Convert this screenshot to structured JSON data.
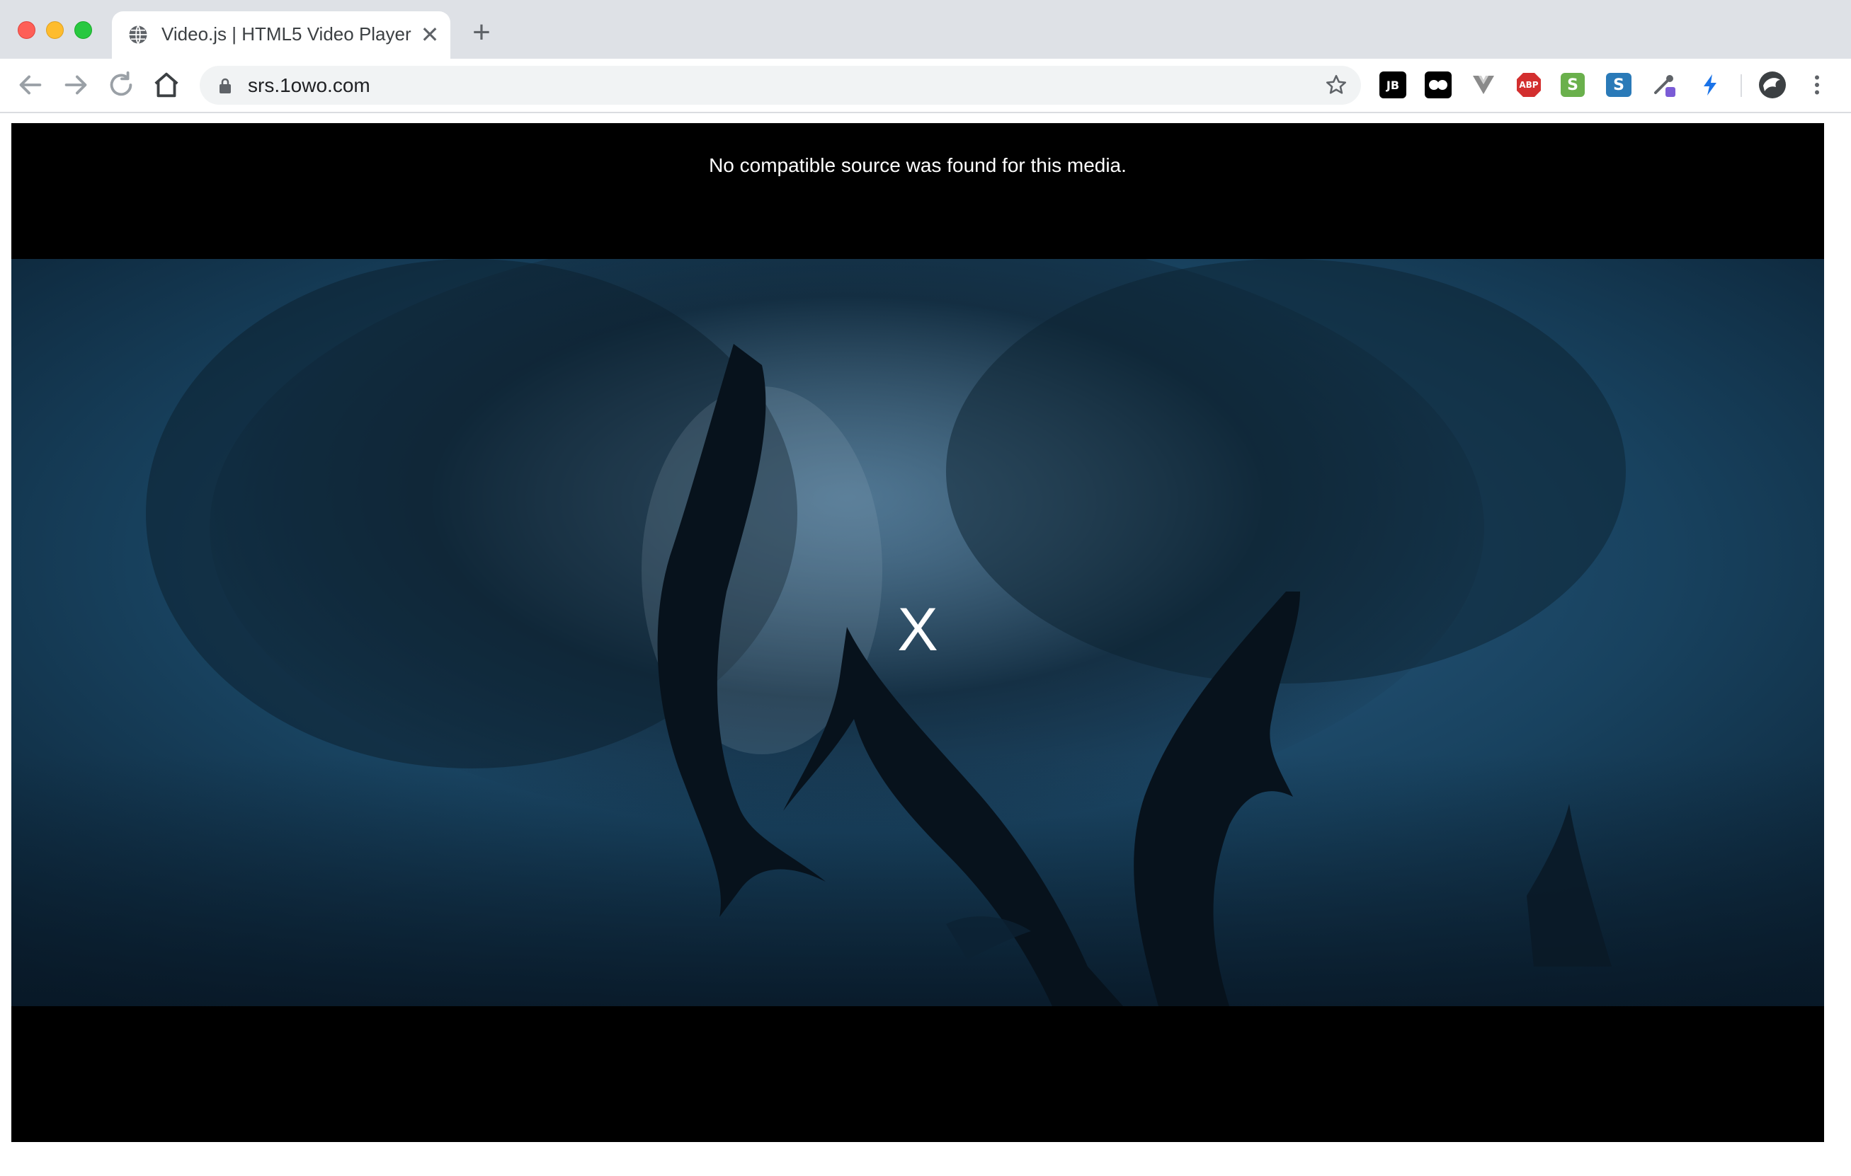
{
  "browser": {
    "tab": {
      "title": "Video.js | HTML5 Video Player",
      "icon": "globe-icon",
      "close_icon": "close-icon"
    },
    "new_tab_icon": "plus-icon",
    "address_bar": {
      "url": "srs.1owo.com",
      "lock_icon": "lock-icon",
      "bookmark_icon": "star-icon"
    },
    "nav": {
      "back_icon": "arrow-left-icon",
      "forward_icon": "arrow-right-icon",
      "reload_icon": "reload-icon",
      "home_icon": "home-icon"
    },
    "extensions": [
      {
        "name": "jetbrains-extension",
        "label": "JB",
        "bg": "#000000",
        "fg": "#ffffff"
      },
      {
        "name": "tampermonkey-extension",
        "label": "",
        "bg": "#000000",
        "fg": "#ffffff"
      },
      {
        "name": "vue-devtools-extension",
        "label": "",
        "bg": "#ffffff",
        "fg": "#8a8a8a"
      },
      {
        "name": "adblock-plus-extension",
        "label": "ABP",
        "bg": "#d32f2f",
        "fg": "#ffffff"
      },
      {
        "name": "s-extension",
        "label": "S",
        "bg": "#6ab04c",
        "fg": "#ffffff"
      },
      {
        "name": "s-blue-extension",
        "label": "S",
        "bg": "#2a7ab8",
        "fg": "#ffffff"
      },
      {
        "name": "eyedropper-extension",
        "label": "",
        "bg": "#ffffff",
        "fg": "#5f6368"
      },
      {
        "name": "lightning-extension",
        "label": "",
        "bg": "#ffffff",
        "fg": "#1a73e8"
      }
    ],
    "profile_icon": "avatar",
    "menu_icon": "kebab-menu-icon"
  },
  "player": {
    "error_message": "No compatible source was found for this media.",
    "error_glyph": "X",
    "poster": "underwater dolphins and fish school"
  },
  "colors": {
    "tab_strip": "#dee1e6",
    "player_bg": "#000000",
    "omnibox": "#f1f3f4"
  }
}
